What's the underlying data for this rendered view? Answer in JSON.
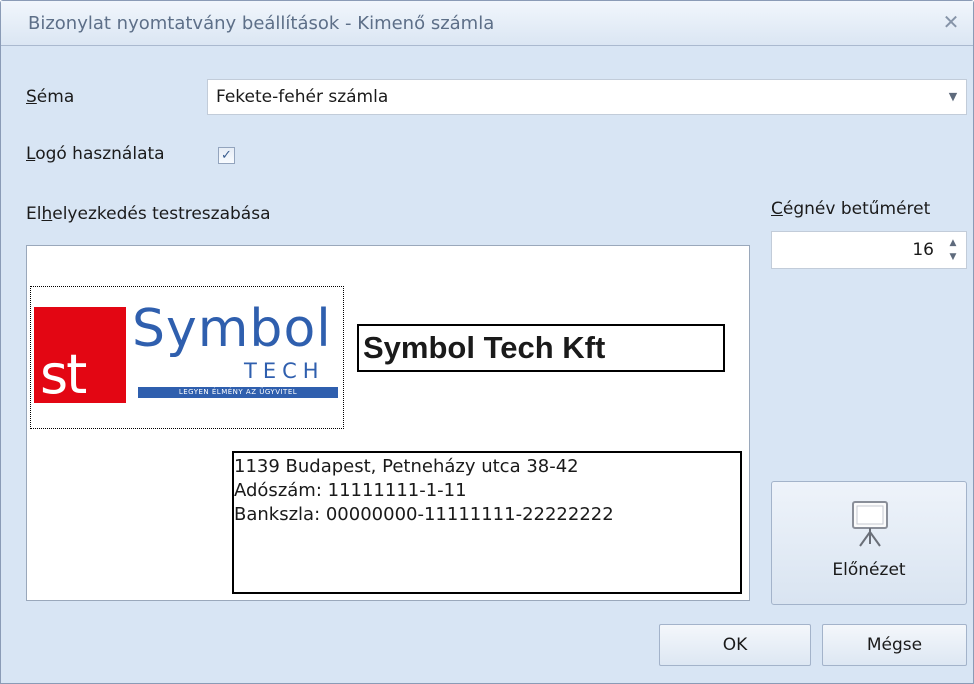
{
  "window": {
    "title": "Bizonylat nyomtatvány beállítások - Kimenő számla",
    "close_glyph": "✕"
  },
  "schema": {
    "label_u": "S",
    "label_rest": "éma",
    "value": "Fekete-fehér számla",
    "arrow_icon": "chevron-down-icon"
  },
  "logo_use": {
    "label_u": "L",
    "label_rest": "ogó használata",
    "checked": true,
    "check_glyph": "✓"
  },
  "layout": {
    "label_pre": "El",
    "label_u": "h",
    "label_rest": "elyezkedés testreszabása"
  },
  "font_size": {
    "label_u": "C",
    "label_rest": "égnév betűméret",
    "value": "16"
  },
  "preview_canvas": {
    "logo": {
      "st": "st",
      "symbol": "Symbol",
      "tech": "TECH",
      "tagline": "LEGYEN ÉLMÉNY AZ ÜGYVITEL"
    },
    "company_name": "Symbol Tech Kft",
    "address_lines": [
      "1139 Budapest, Petneházy utca 38-42",
      "Adószám: 11111111-1-11",
      "Bankszla: 00000000-11111111-22222222"
    ]
  },
  "buttons": {
    "preview": "Előnézet",
    "preview_icon": "presentation-board-icon",
    "ok": "OK",
    "cancel": "Mégse"
  },
  "colors": {
    "logo_red": "#e30613",
    "logo_blue": "#2f5fae",
    "window_bg": "#d8e5f4"
  }
}
